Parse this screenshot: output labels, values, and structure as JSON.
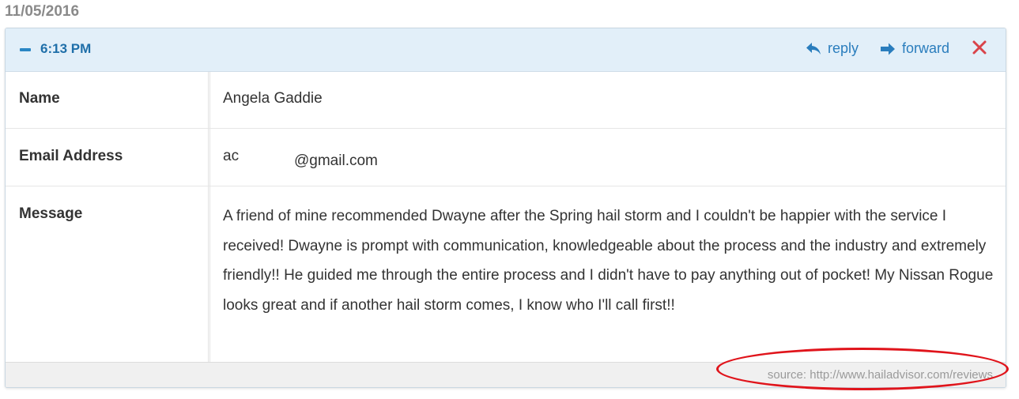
{
  "date": "11/05/2016",
  "header": {
    "time": "6:13 PM",
    "reply_label": "reply",
    "forward_label": "forward",
    "accent_color": "#2a7dbd",
    "close_color": "#d9434a"
  },
  "fields": {
    "name_label": "Name",
    "name_value": "Angela Gaddie",
    "email_label": "Email Address",
    "email_local": "ac",
    "email_domain": "@gmail.com",
    "message_label": "Message",
    "message_value": "A friend of mine recommended Dwayne after the Spring hail storm and I couldn't be happier with the service I received! Dwayne is prompt with communication, knowledgeable about the process and the industry and extremely friendly!! He guided me through the entire process and I didn't have to pay anything out of pocket! My Nissan Rogue looks great and if another hail storm comes, I know who I'll call first!!"
  },
  "footer": {
    "source_text": "source: http://www.hailadvisor.com/reviews"
  },
  "icons": {
    "collapse": "minus-icon",
    "reply": "reply-arrow-icon",
    "forward": "forward-arrow-icon",
    "close": "close-x-icon"
  },
  "annotation_color": "#e0141b"
}
